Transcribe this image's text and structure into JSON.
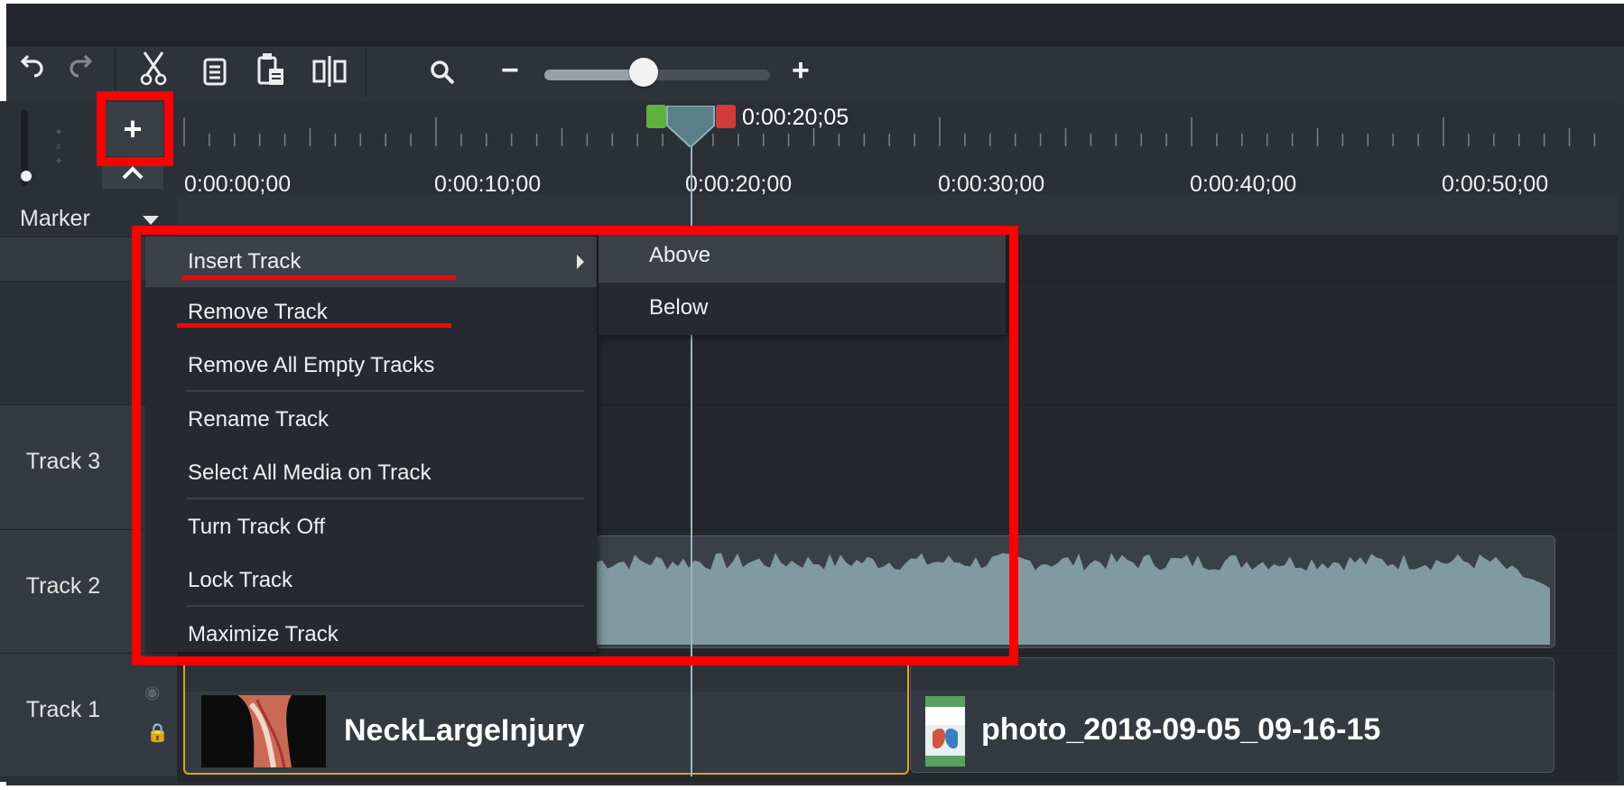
{
  "toolbar": {
    "tools": [
      {
        "icon": "undo-icon",
        "glyph": "↶"
      },
      {
        "icon": "redo-icon",
        "glyph": "↷"
      },
      {
        "icon": "cut-icon",
        "glyph": "✂"
      },
      {
        "icon": "copy-icon",
        "glyph": "▤"
      },
      {
        "icon": "paste-icon",
        "glyph": "▦"
      },
      {
        "icon": "split-icon",
        "glyph": "◧"
      }
    ],
    "zoom": {
      "search_icon": "search-icon",
      "minus": "−",
      "plus": "+",
      "level": 0.44
    }
  },
  "timeline": {
    "add_track_button": "+",
    "collapse_button": "^",
    "playhead_time": "0:00:20;05",
    "ruler_labels": [
      "0:00:00;00",
      "0:00:10;00",
      "0:00:20;00",
      "0:00:30;00",
      "0:00:40;00",
      "0:00:50;00"
    ],
    "marker_label": "Marker",
    "tracks": [
      "Track 3",
      "Track 2",
      "Track 1"
    ],
    "clips": {
      "clip_1": "NeckLargeInjury",
      "clip_2": "photo_2018-09-05_09-16-15"
    }
  },
  "context_menu": {
    "items": [
      "Insert Track",
      "Remove Track",
      "Remove All Empty Tracks",
      "Rename Track",
      "Select All Media on Track",
      "Turn Track Off",
      "Lock Track",
      "Maximize Track"
    ],
    "submenu": [
      "Above",
      "Below"
    ]
  },
  "colors": {
    "annotation": "#ff0000",
    "playhead": "#5a7f88",
    "background": "#2b2f36"
  }
}
